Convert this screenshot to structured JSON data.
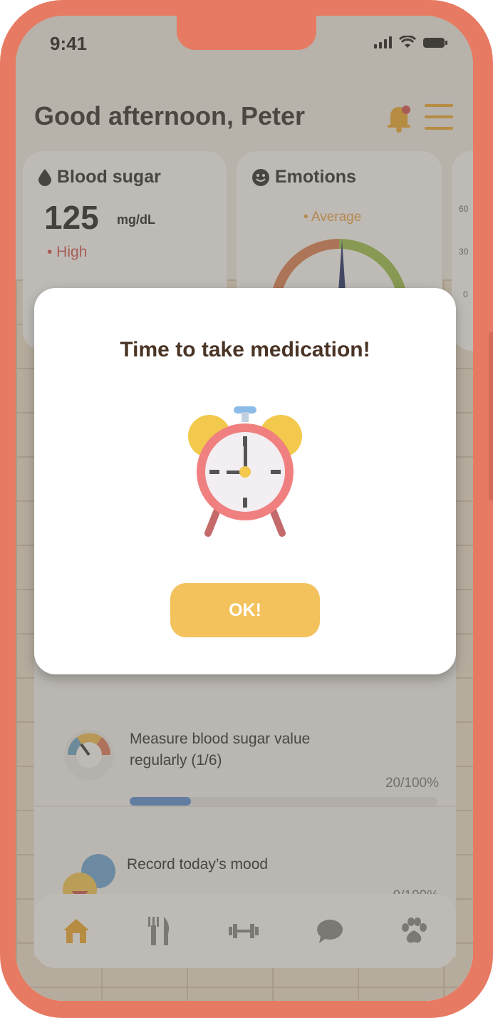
{
  "status_bar": {
    "time": "9:41"
  },
  "header": {
    "greeting": "Good afternoon, Peter"
  },
  "cards": {
    "blood_sugar": {
      "title": "Blood sugar",
      "value": "125",
      "unit": "mg/dL",
      "status": "• High"
    },
    "emotions": {
      "title": "Emotions",
      "status": "• Average"
    },
    "third_card_ticks": [
      "60",
      "30",
      "0"
    ]
  },
  "tasks": [
    {
      "label": "Measure blood sugar value regularly (1/6)",
      "percent_text": "20/100%",
      "progress": 0.2
    },
    {
      "label": "Record today’s mood",
      "percent_text": "0/100%",
      "progress": 0
    }
  ],
  "modal": {
    "title": "Time to take medication!",
    "ok_label": "OK!"
  },
  "nav_items": [
    "home-icon",
    "utensils-icon",
    "dumbbell-icon",
    "chat-icon",
    "paw-icon"
  ],
  "colors": {
    "frame": "#e77a62",
    "accent": "#f0a92b",
    "ok_button": "#f4c25c",
    "danger": "#d9534f"
  }
}
